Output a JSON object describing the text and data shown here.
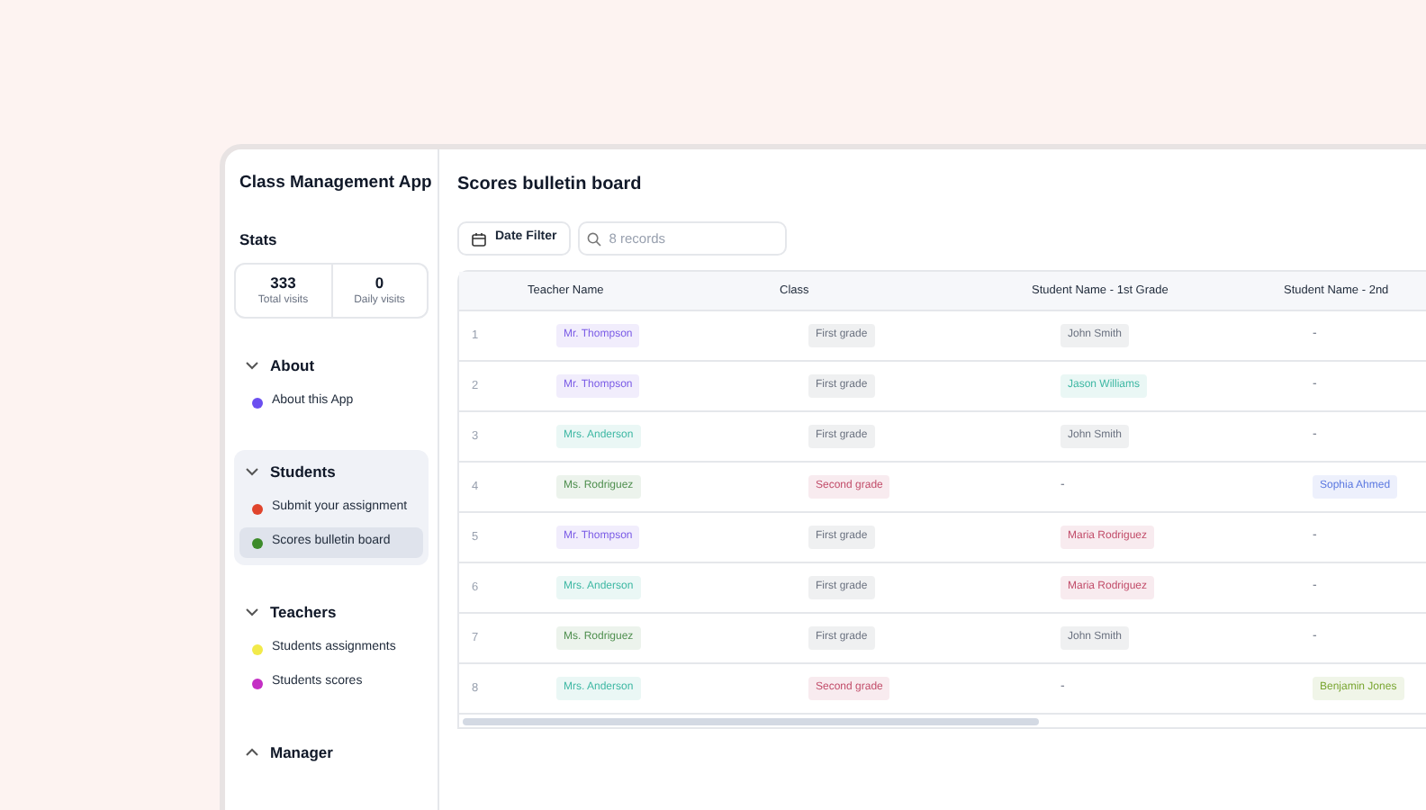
{
  "app": {
    "title": "Class Management App"
  },
  "stats": {
    "title": "Stats",
    "items": [
      {
        "value": "333",
        "label": "Total visits"
      },
      {
        "value": "0",
        "label": "Daily visits"
      }
    ]
  },
  "nav": [
    {
      "title": "About",
      "expanded": true,
      "active": false,
      "items": [
        {
          "label": "About this App",
          "color": "#6b4ff0",
          "selected": false
        }
      ]
    },
    {
      "title": "Students",
      "expanded": true,
      "active": true,
      "items": [
        {
          "label": "Submit your assignment",
          "color": "#e0442c",
          "selected": false
        },
        {
          "label": "Scores bulletin board",
          "color": "#3d8b2a",
          "selected": true
        }
      ]
    },
    {
      "title": "Teachers",
      "expanded": true,
      "active": false,
      "items": [
        {
          "label": "Students assignments",
          "color": "#f2ea4a",
          "selected": false
        },
        {
          "label": "Students scores",
          "color": "#c42fc4",
          "selected": false
        }
      ]
    },
    {
      "title": "Manager",
      "expanded": false,
      "active": false
    }
  ],
  "page": {
    "title": "Scores bulletin board"
  },
  "toolbar": {
    "date_filter": "Date Filter",
    "search": {
      "placeholder": "8 records"
    }
  },
  "table": {
    "columns": [
      "Teacher Name",
      "Class",
      "Student Name - 1st Grade",
      "Student Name - 2nd"
    ],
    "rows": [
      {
        "index": "1",
        "cells": [
          {
            "kind": "tag",
            "text": "Mr. Thompson",
            "color": "#7b5ce6"
          },
          {
            "kind": "tag",
            "text": "First grade",
            "color": "#6b7280"
          },
          {
            "kind": "tag",
            "text": "John Smith",
            "color": "#6b7280"
          },
          {
            "kind": "empty",
            "text": "-"
          }
        ]
      },
      {
        "index": "2",
        "cells": [
          {
            "kind": "tag",
            "text": "Mr. Thompson",
            "color": "#7b5ce6"
          },
          {
            "kind": "tag",
            "text": "First grade",
            "color": "#6b7280"
          },
          {
            "kind": "tag",
            "text": "Jason Williams",
            "color": "#3fb8a4"
          },
          {
            "kind": "empty",
            "text": "-"
          }
        ]
      },
      {
        "index": "3",
        "cells": [
          {
            "kind": "tag",
            "text": "Mrs. Anderson",
            "color": "#3fb8a4"
          },
          {
            "kind": "tag",
            "text": "First grade",
            "color": "#6b7280"
          },
          {
            "kind": "tag",
            "text": "John Smith",
            "color": "#6b7280"
          },
          {
            "kind": "empty",
            "text": "-"
          }
        ]
      },
      {
        "index": "4",
        "cells": [
          {
            "kind": "tag",
            "text": "Ms. Rodriguez",
            "color": "#4f8f4f"
          },
          {
            "kind": "tag",
            "text": "Second grade",
            "color": "#c24d6a"
          },
          {
            "kind": "empty",
            "text": "-"
          },
          {
            "kind": "tag",
            "text": "Sophia Ahmed",
            "color": "#5b78e0"
          }
        ]
      },
      {
        "index": "5",
        "cells": [
          {
            "kind": "tag",
            "text": "Mr. Thompson",
            "color": "#7b5ce6"
          },
          {
            "kind": "tag",
            "text": "First grade",
            "color": "#6b7280"
          },
          {
            "kind": "tag",
            "text": "Maria Rodriguez",
            "color": "#c24d6a"
          },
          {
            "kind": "empty",
            "text": "-"
          }
        ]
      },
      {
        "index": "6",
        "cells": [
          {
            "kind": "tag",
            "text": "Mrs. Anderson",
            "color": "#3fb8a4"
          },
          {
            "kind": "tag",
            "text": "First grade",
            "color": "#6b7280"
          },
          {
            "kind": "tag",
            "text": "Maria Rodriguez",
            "color": "#c24d6a"
          },
          {
            "kind": "empty",
            "text": "-"
          }
        ]
      },
      {
        "index": "7",
        "cells": [
          {
            "kind": "tag",
            "text": "Ms. Rodriguez",
            "color": "#4f8f4f"
          },
          {
            "kind": "tag",
            "text": "First grade",
            "color": "#6b7280"
          },
          {
            "kind": "tag",
            "text": "John Smith",
            "color": "#6b7280"
          },
          {
            "kind": "empty",
            "text": "-"
          }
        ]
      },
      {
        "index": "8",
        "cells": [
          {
            "kind": "tag",
            "text": "Mrs. Anderson",
            "color": "#3fb8a4"
          },
          {
            "kind": "tag",
            "text": "Second grade",
            "color": "#c24d6a"
          },
          {
            "kind": "empty",
            "text": "-"
          },
          {
            "kind": "tag",
            "text": "Benjamin Jones",
            "color": "#7aa632"
          }
        ]
      }
    ]
  }
}
